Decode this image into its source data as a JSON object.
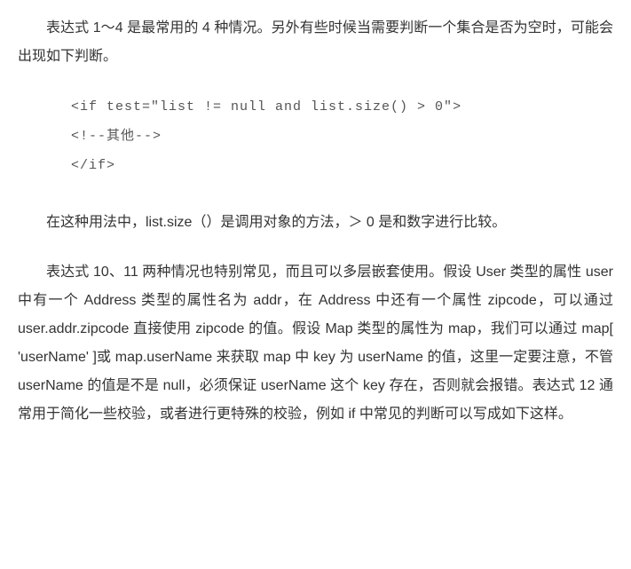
{
  "paragraphs": {
    "p1": "表达式 1～4 是最常用的 4 种情况。另外有些时候当需要判断一个集合是否为空时，可能会出现如下判断。",
    "code1_line1": "<if test=\"list != null and list.size() > 0\">",
    "code1_line2": "<!--其他-->",
    "code1_line3": "</if>",
    "p2": "在这种用法中，list.size（）是调用对象的方法，＞ 0 是和数字进行比较。",
    "p3": "表达式 10、11 两种情况也特别常见，而且可以多层嵌套使用。假设 User 类型的属性 user 中有一个 Address 类型的属性名为 addr，在 Address 中还有一个属性 zipcode，可以通过 user.addr.zipcode 直接使用 zipcode 的值。假设 Map 类型的属性为 map，我们可以通过 map[ 'userName' ]或 map.userName 来获取 map 中 key 为 userName 的值，这里一定要注意，不管 userName 的值是不是 null，必须保证 userName 这个 key 存在，否则就会报错。表达式 12 通常用于简化一些校验，或者进行更特殊的校验，例如 if 中常见的判断可以写成如下这样。"
  }
}
